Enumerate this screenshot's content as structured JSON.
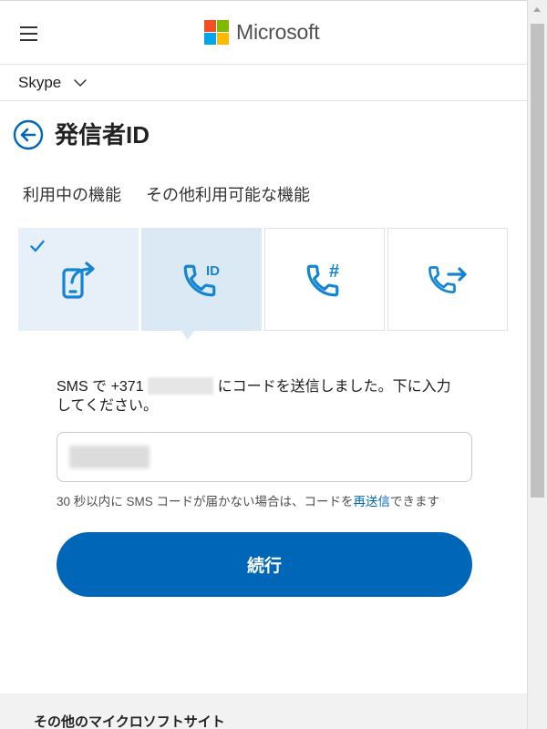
{
  "colors": {
    "accent": "#0067b8",
    "icon_blue": "#1485d2",
    "tile_checked_bg": "#e7f0f8",
    "tile_selected_bg": "#dbe9f5",
    "footer_bg": "#f2f2f2"
  },
  "header": {
    "menu_icon": "hamburger-menu-icon",
    "logo_icon": "microsoft-logo-icon",
    "logo_colors": [
      "#f25022",
      "#7fba00",
      "#00a4ef",
      "#ffb900"
    ],
    "brand": "Microsoft"
  },
  "product_nav": {
    "label": "Skype",
    "icon": "chevron-down-icon"
  },
  "page_header": {
    "back_icon": "back-arrow-icon",
    "title": "発信者ID"
  },
  "feature_groups": [
    {
      "label": "利用中の機能"
    },
    {
      "label": "その他利用可能な機能"
    }
  ],
  "features": [
    {
      "icon": "mobile-forward-icon",
      "checked": true,
      "selected": false
    },
    {
      "icon": "caller-id-icon",
      "icon_text": "ID",
      "checked": false,
      "selected": true
    },
    {
      "icon": "skype-number-icon",
      "icon_text": "#",
      "checked": false,
      "selected": false
    },
    {
      "icon": "call-forwarding-icon",
      "checked": false,
      "selected": false
    }
  ],
  "verification": {
    "message_prefix": "SMS で +371",
    "message_suffix": "にコードを送信しました。下に入力してください。",
    "resend_prefix": "30 秒以内に SMS コードが届かない場合は、コードを",
    "resend_link": "再送信",
    "resend_suffix": "できます",
    "continue_label": "続行"
  },
  "footer": {
    "title": "その他のマイクロソフトサイト"
  }
}
